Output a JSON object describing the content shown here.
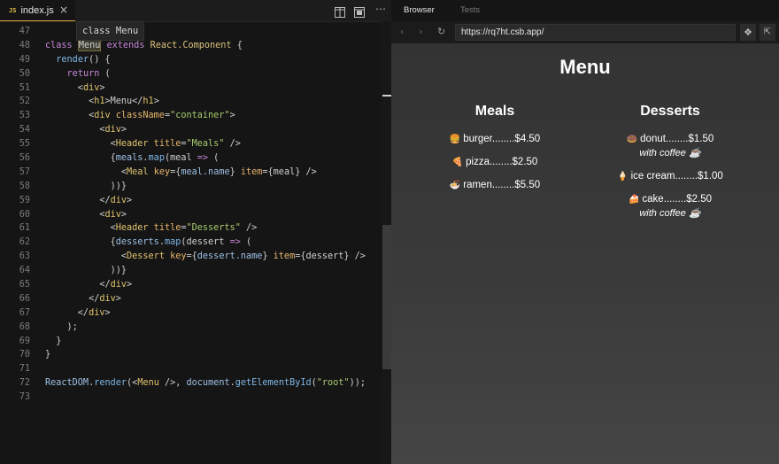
{
  "editor": {
    "tab": {
      "badge": "JS",
      "filename": "index.js",
      "close": "×"
    },
    "toolbar_icons": [
      "split-editor-icon",
      "preview-icon",
      "more-icon"
    ],
    "more_glyph": "⋯",
    "hover_tooltip": "class Menu",
    "lines": [
      {
        "n": "47",
        "tokens": []
      },
      {
        "n": "48",
        "tokens": [
          [
            "kw",
            "class "
          ],
          [
            "hl",
            "Menu"
          ],
          [
            "kw",
            " extends "
          ],
          [
            "cls",
            "React.Component"
          ],
          [
            "br",
            " {"
          ]
        ]
      },
      {
        "n": "49",
        "tokens": [
          [
            "br",
            "  "
          ],
          [
            "fn",
            "render"
          ],
          [
            "br",
            "() {"
          ]
        ]
      },
      {
        "n": "50",
        "tokens": [
          [
            "br",
            "    "
          ],
          [
            "kw",
            "return"
          ],
          [
            "br",
            " ("
          ]
        ]
      },
      {
        "n": "51",
        "tokens": [
          [
            "br",
            "      <"
          ],
          [
            "tag",
            "div"
          ],
          [
            "br",
            ">"
          ]
        ]
      },
      {
        "n": "52",
        "tokens": [
          [
            "br",
            "        <"
          ],
          [
            "tag",
            "h1"
          ],
          [
            "br",
            ">Menu</"
          ],
          [
            "tag",
            "h1"
          ],
          [
            "br",
            ">"
          ]
        ]
      },
      {
        "n": "53",
        "tokens": [
          [
            "br",
            "        <"
          ],
          [
            "tag",
            "div"
          ],
          [
            "attr",
            " className"
          ],
          [
            "br",
            "="
          ],
          [
            "str",
            "\"container\""
          ],
          [
            "br",
            ">"
          ]
        ]
      },
      {
        "n": "54",
        "tokens": [
          [
            "br",
            "          <"
          ],
          [
            "tag",
            "div"
          ],
          [
            "br",
            ">"
          ]
        ]
      },
      {
        "n": "55",
        "tokens": [
          [
            "br",
            "            <"
          ],
          [
            "tag",
            "Header"
          ],
          [
            "attr",
            " title"
          ],
          [
            "br",
            "="
          ],
          [
            "str",
            "\"Meals\""
          ],
          [
            "br",
            " />"
          ]
        ]
      },
      {
        "n": "56",
        "tokens": [
          [
            "br",
            "            {"
          ],
          [
            "var",
            "meals"
          ],
          [
            "br",
            "."
          ],
          [
            "fn",
            "map"
          ],
          [
            "br",
            "(meal "
          ],
          [
            "kw",
            "=>"
          ],
          [
            "br",
            " ("
          ]
        ]
      },
      {
        "n": "57",
        "tokens": [
          [
            "br",
            "              <"
          ],
          [
            "tag",
            "Meal"
          ],
          [
            "attr",
            " key"
          ],
          [
            "br",
            "={"
          ],
          [
            "var",
            "meal.name"
          ],
          [
            "br",
            "}"
          ],
          [
            "attr",
            " item"
          ],
          [
            "br",
            "={meal} />"
          ]
        ]
      },
      {
        "n": "58",
        "tokens": [
          [
            "br",
            "            ))}"
          ]
        ]
      },
      {
        "n": "59",
        "tokens": [
          [
            "br",
            "          </"
          ],
          [
            "tag",
            "div"
          ],
          [
            "br",
            ">"
          ]
        ]
      },
      {
        "n": "60",
        "tokens": [
          [
            "br",
            "          <"
          ],
          [
            "tag",
            "div"
          ],
          [
            "br",
            ">"
          ]
        ]
      },
      {
        "n": "61",
        "tokens": [
          [
            "br",
            "            <"
          ],
          [
            "tag",
            "Header"
          ],
          [
            "attr",
            " title"
          ],
          [
            "br",
            "="
          ],
          [
            "str",
            "\"Desserts\""
          ],
          [
            "br",
            " />"
          ]
        ]
      },
      {
        "n": "62",
        "tokens": [
          [
            "br",
            "            {"
          ],
          [
            "var",
            "desserts"
          ],
          [
            "br",
            "."
          ],
          [
            "fn",
            "map"
          ],
          [
            "br",
            "(dessert "
          ],
          [
            "kw",
            "=>"
          ],
          [
            "br",
            " ("
          ]
        ]
      },
      {
        "n": "63",
        "tokens": [
          [
            "br",
            "              <"
          ],
          [
            "tag",
            "Dessert"
          ],
          [
            "attr",
            " key"
          ],
          [
            "br",
            "={"
          ],
          [
            "var",
            "dessert.name"
          ],
          [
            "br",
            "}"
          ],
          [
            "attr",
            " item"
          ],
          [
            "br",
            "={dessert} />"
          ]
        ]
      },
      {
        "n": "64",
        "tokens": [
          [
            "br",
            "            ))}"
          ]
        ]
      },
      {
        "n": "65",
        "tokens": [
          [
            "br",
            "          </"
          ],
          [
            "tag",
            "div"
          ],
          [
            "br",
            ">"
          ]
        ]
      },
      {
        "n": "66",
        "tokens": [
          [
            "br",
            "        </"
          ],
          [
            "tag",
            "div"
          ],
          [
            "br",
            ">"
          ]
        ]
      },
      {
        "n": "67",
        "tokens": [
          [
            "br",
            "      </"
          ],
          [
            "tag",
            "div"
          ],
          [
            "br",
            ">"
          ]
        ]
      },
      {
        "n": "68",
        "tokens": [
          [
            "br",
            "    );"
          ]
        ]
      },
      {
        "n": "69",
        "tokens": [
          [
            "br",
            "  }"
          ]
        ]
      },
      {
        "n": "70",
        "tokens": [
          [
            "br",
            "}"
          ]
        ]
      },
      {
        "n": "71",
        "tokens": []
      },
      {
        "n": "72",
        "tokens": [
          [
            "var",
            "ReactDOM"
          ],
          [
            "br",
            "."
          ],
          [
            "fn",
            "render"
          ],
          [
            "br",
            "(<"
          ],
          [
            "tag",
            "Menu"
          ],
          [
            "br",
            " />, "
          ],
          [
            "var",
            "document"
          ],
          [
            "br",
            "."
          ],
          [
            "fn",
            "getElementById"
          ],
          [
            "br",
            "("
          ],
          [
            "str",
            "\"root\""
          ],
          [
            "br",
            "));"
          ]
        ]
      },
      {
        "n": "73",
        "tokens": []
      }
    ]
  },
  "browser": {
    "tabs": {
      "browser": "Browser",
      "tests": "Tests"
    },
    "nav": {
      "back": "‹",
      "forward": "›",
      "reload": "↻"
    },
    "url": "https://rq7ht.csb.app/",
    "csb_glyph": "❖",
    "open_glyph": "⇱",
    "page": {
      "heading": "Menu",
      "meals": {
        "title": "Meals",
        "items": [
          {
            "emoji": "🍔",
            "text": "burger........$4.50"
          },
          {
            "emoji": "🍕",
            "text": "pizza........$2.50"
          },
          {
            "emoji": "🍜",
            "text": "ramen........$5.50"
          }
        ]
      },
      "desserts": {
        "title": "Desserts",
        "items": [
          {
            "emoji": "🍩",
            "text": "donut........$1.50",
            "note": "with coffee ☕"
          },
          {
            "emoji": "🍦",
            "text": "ice cream........$1.00"
          },
          {
            "emoji": "🍰",
            "text": "cake........$2.50",
            "note": "with coffee ☕"
          }
        ]
      }
    }
  }
}
